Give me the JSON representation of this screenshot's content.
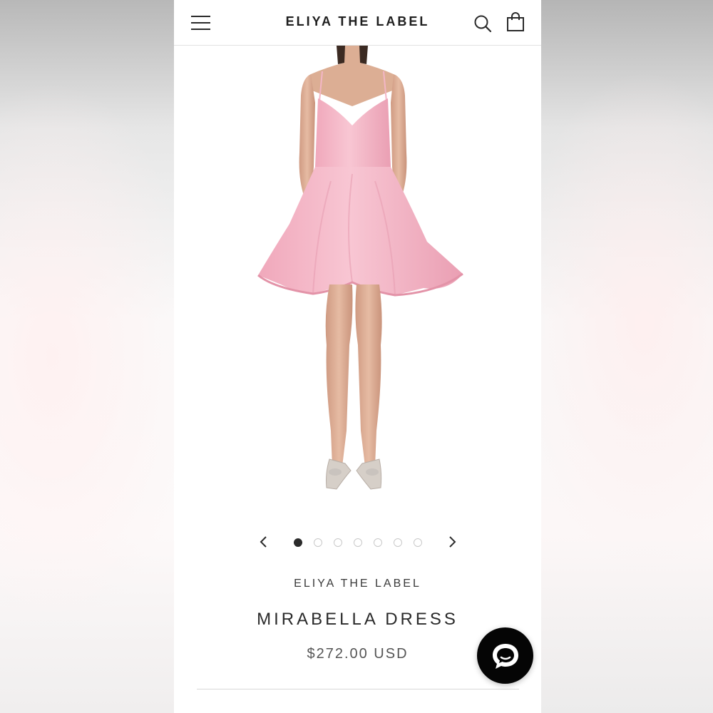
{
  "header": {
    "brand": "ELIYA THE LABEL",
    "menu_icon": "hamburger-menu-icon",
    "search_icon": "search-icon",
    "cart_icon": "shopping-bag-icon"
  },
  "gallery": {
    "image_alt": "Model wearing pink jacquard mini dress",
    "dot_count": 7,
    "active_index": 0,
    "prev_icon": "chevron-left-icon",
    "next_icon": "chevron-right-icon"
  },
  "product": {
    "vendor": "ELIYA THE LABEL",
    "title": "MIRABELLA DRESS",
    "price": "$272.00 USD"
  },
  "chat": {
    "icon": "chat-bubble-icon"
  },
  "colors": {
    "dress": "#f4b6c7",
    "dress_shadow": "#e79ab0",
    "skin": "#e3b59d",
    "text": "#2a2a2a",
    "chat_bg": "#050505"
  }
}
